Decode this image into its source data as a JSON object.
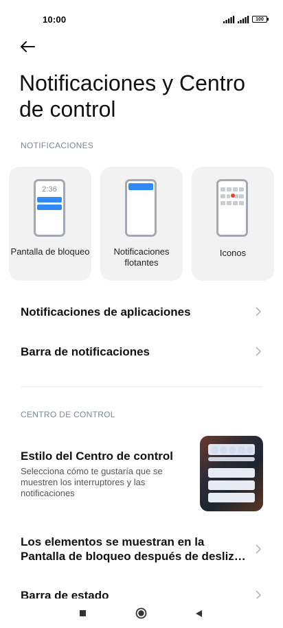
{
  "status_bar": {
    "time": "10:00",
    "battery": "100"
  },
  "header": {
    "title": "Notificaciones y Centro de control"
  },
  "notifications_section": {
    "label": "NOTIFICACIONES",
    "cards": [
      {
        "label": "Pantalla de bloqueo",
        "preview_time": "2:36"
      },
      {
        "label": "Notificaciones flotantes"
      },
      {
        "label": "Iconos"
      }
    ],
    "rows": [
      {
        "title": "Notificaciones de aplicaciones"
      },
      {
        "title": "Barra de notificaciones"
      }
    ]
  },
  "control_center_section": {
    "label": "CENTRO DE CONTROL",
    "style_item": {
      "title": "Estilo del Centro de control",
      "description": "Selecciona cómo te gustaría que se muestren los interruptores y las notificaciones"
    },
    "lockscreen_item": {
      "title": "Los elementos se muestran en la Pantalla de bloqueo después de desliz…"
    },
    "status_bar_item": {
      "title": "Barra de estado"
    }
  },
  "colors": {
    "accent_blue": "#2f8af5",
    "section_label": "#7d8797",
    "card_background": "#f2f2f2",
    "notification_dot": "#f04134"
  },
  "icons": {
    "back": "back-arrow-icon",
    "chevron": "chevron-right-icon",
    "nav_recents": "square-recents-icon",
    "nav_home": "circle-home-icon",
    "nav_back": "triangle-back-icon"
  }
}
